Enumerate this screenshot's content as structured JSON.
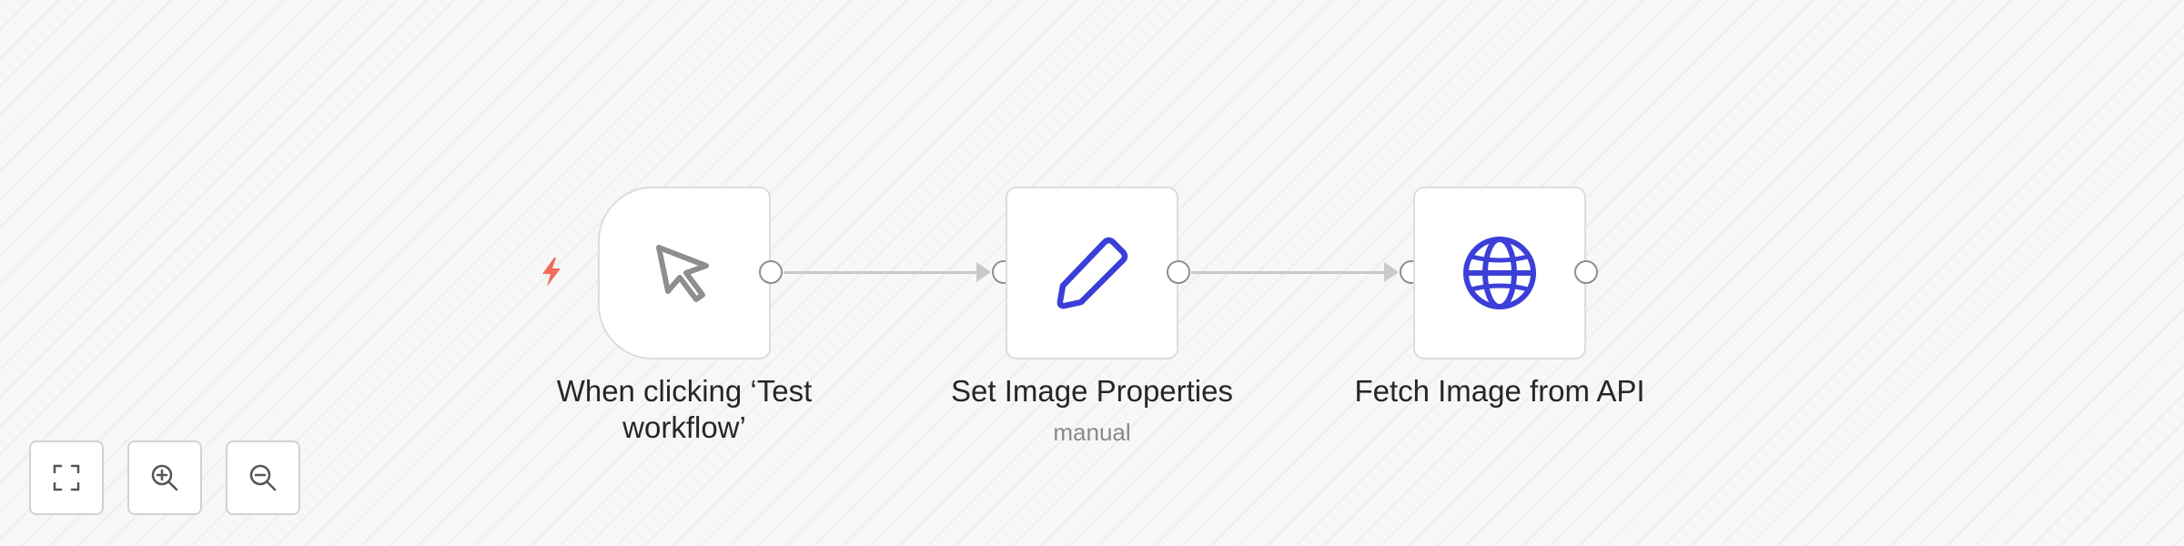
{
  "canvas": {
    "background": "#f7f7f7",
    "accent_color": "#3b3fd8",
    "trigger_bolt_color": "#f26b5b"
  },
  "nodes": [
    {
      "id": "trigger",
      "label": "When clicking ‘Test workflow’",
      "subtitle": "",
      "icon": "cursor-pointer-icon"
    },
    {
      "id": "set",
      "label": "Set Image Properties",
      "subtitle": "manual",
      "icon": "pencil-icon"
    },
    {
      "id": "http",
      "label": "Fetch Image from API",
      "subtitle": "",
      "icon": "globe-icon"
    }
  ],
  "controls": [
    {
      "name": "fit-view",
      "icon": "fullscreen-icon"
    },
    {
      "name": "zoom-in",
      "icon": "zoom-in-icon"
    },
    {
      "name": "zoom-out",
      "icon": "zoom-out-icon"
    }
  ]
}
